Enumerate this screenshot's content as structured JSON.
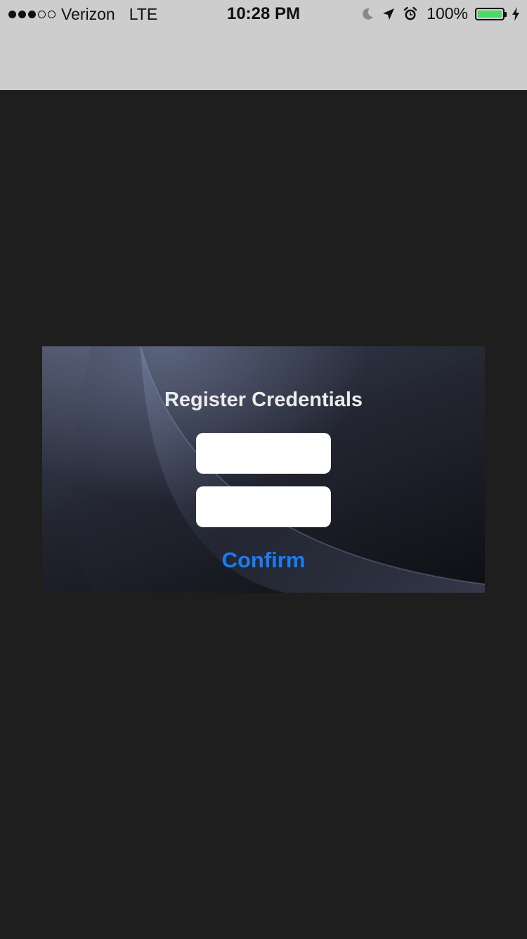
{
  "status_bar": {
    "carrier": "Verizon",
    "network": "LTE",
    "time": "10:28 PM",
    "battery": "100%",
    "signal_bars_filled": 3,
    "signal_bars_total": 5,
    "battery_level": 1.0,
    "icons": [
      "moon-icon",
      "location-arrow-icon",
      "alarm-icon",
      "battery-icon",
      "charging-bolt-icon"
    ],
    "battery_color": "#4cd964"
  },
  "dialog": {
    "title": "Register Credentials",
    "fields": [
      {
        "value": "",
        "placeholder": ""
      },
      {
        "value": "",
        "placeholder": ""
      }
    ],
    "confirm_label": "Confirm",
    "confirm_color": "#1a7cf2"
  },
  "colors": {
    "background": "#1e1e1e",
    "status_bar_bg": "#cdcdcd"
  }
}
